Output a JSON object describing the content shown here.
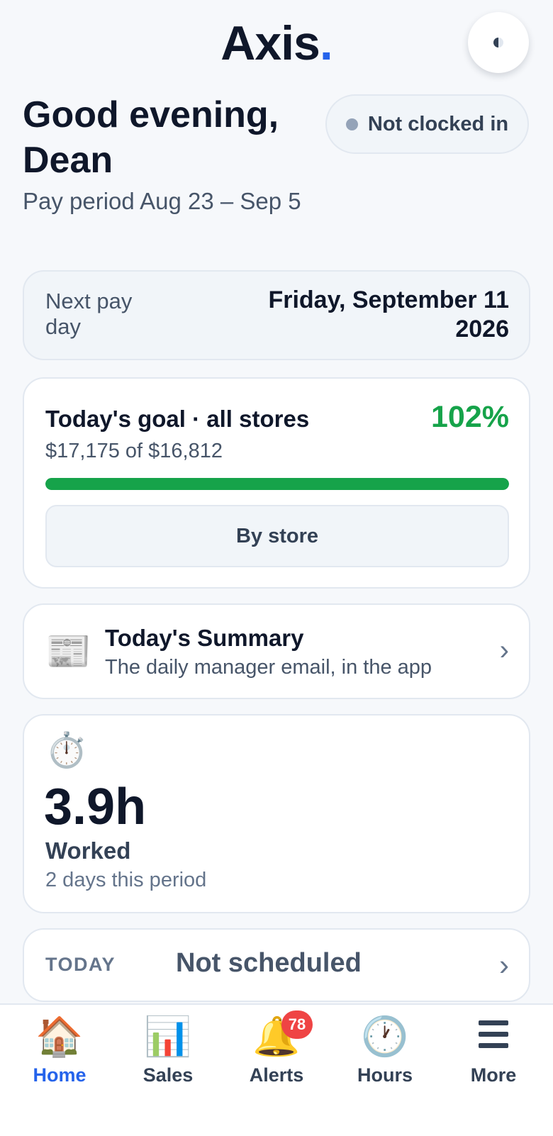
{
  "header": {
    "logo_text": "Axis",
    "logo_dot": ".",
    "theme_icon": "half-moon-icon"
  },
  "greeting": {
    "title": "Good evening, Dean",
    "pay_period": "Pay period Aug 23 – Sep 5",
    "clock_status": "Not clocked in"
  },
  "next_pay": {
    "label": "Next pay day",
    "date": "Friday, September 11 2026"
  },
  "goal": {
    "title": "Today's goal · all stores",
    "percent": "102%",
    "progress": "$17,175 of $16,812",
    "progress_fraction": 1.0,
    "button": "By store",
    "accent_color": "#16a34a"
  },
  "summary": {
    "icon": "newspaper-icon",
    "glyph": "📰",
    "title": "Today's Summary",
    "subtitle": "The daily manager email, in the app",
    "chevron": "›"
  },
  "worked": {
    "icon": "stopwatch-icon",
    "glyph": "⏱️",
    "value": "3.9h",
    "label": "Worked",
    "subtitle": "2 days this period"
  },
  "today": {
    "tag": "TODAY",
    "value": "Not scheduled",
    "chevron": "›"
  },
  "nav": {
    "items": [
      {
        "label": "Home",
        "glyph": "🏠",
        "icon": "home-icon",
        "active": true
      },
      {
        "label": "Sales",
        "glyph": "📊",
        "icon": "bar-chart-icon"
      },
      {
        "label": "Alerts",
        "glyph": "🔔",
        "icon": "bell-icon",
        "badge": "78"
      },
      {
        "label": "Hours",
        "glyph": "🕐",
        "icon": "clock-icon"
      },
      {
        "label": "More",
        "icon": "menu-icon"
      }
    ]
  },
  "colors": {
    "brand": "#2563eb",
    "success": "#16a34a",
    "badge": "#ef4444"
  }
}
